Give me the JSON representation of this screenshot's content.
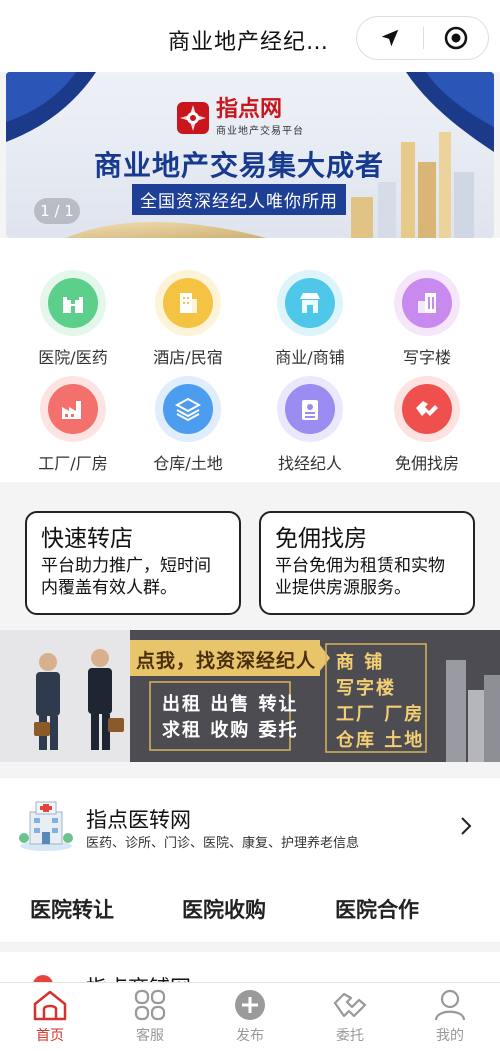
{
  "header": {
    "title": "商业地产经纪…"
  },
  "banner": {
    "logo_name": "指点网",
    "logo_sub": "商业地产交易平台",
    "slogan": "商业地产交易集大成者",
    "tagline": "全国资深经纪人唯你所用",
    "counter": "1 / 1"
  },
  "categories": [
    {
      "label": "医院/医药",
      "icon": "hospital-icon",
      "color": "#5ccf8a"
    },
    {
      "label": "酒店/民宿",
      "icon": "hotel-icon",
      "color": "#f5c343"
    },
    {
      "label": "商业/商铺",
      "icon": "shop-icon",
      "color": "#4fc7e8"
    },
    {
      "label": "写字楼",
      "icon": "office-building-icon",
      "color": "#c98af0"
    },
    {
      "label": "工厂/厂房",
      "icon": "factory-icon",
      "color": "#f3706d"
    },
    {
      "label": "仓库/土地",
      "icon": "warehouse-layers-icon",
      "color": "#4c9cf0"
    },
    {
      "label": "找经纪人",
      "icon": "agent-badge-icon",
      "color": "#9a8cf0"
    },
    {
      "label": "免佣找房",
      "icon": "handshake-icon",
      "color": "#f0504d"
    }
  ],
  "promos": [
    {
      "title": "快速转店",
      "desc": "平台助力推广，短时间内覆盖有效人群。"
    },
    {
      "title": "免佣找房",
      "desc": "平台免佣为租赁和实物业提供房源服务。"
    }
  ],
  "agent_banner": {
    "headline": "点我，找资深经纪人",
    "line1": "出租 出售 转让",
    "line2": "求租 收购 委托",
    "right1": "商  铺",
    "right2": "写字楼",
    "right3": "工厂 厂房",
    "right4": "仓库 土地"
  },
  "hospital_section": {
    "title": "指点医转网",
    "subtitle": "医药、诊所、门诊、医院、康复、护理养老信息",
    "links": [
      "医院转让",
      "医院收购",
      "医院合作"
    ]
  },
  "next_section": {
    "title": "指点商铺网"
  },
  "tabbar": {
    "items": [
      {
        "label": "首页",
        "icon": "home-icon",
        "active": true
      },
      {
        "label": "客服",
        "icon": "grid-icon",
        "active": false
      },
      {
        "label": "发布",
        "icon": "plus-circle-icon",
        "active": false
      },
      {
        "label": "委托",
        "icon": "handshake-icon",
        "active": false
      },
      {
        "label": "我的",
        "icon": "user-icon",
        "active": false
      }
    ]
  },
  "colors": {
    "accent": "#d5322b",
    "brand_blue": "#173a8f",
    "tab_inactive": "#999999"
  }
}
